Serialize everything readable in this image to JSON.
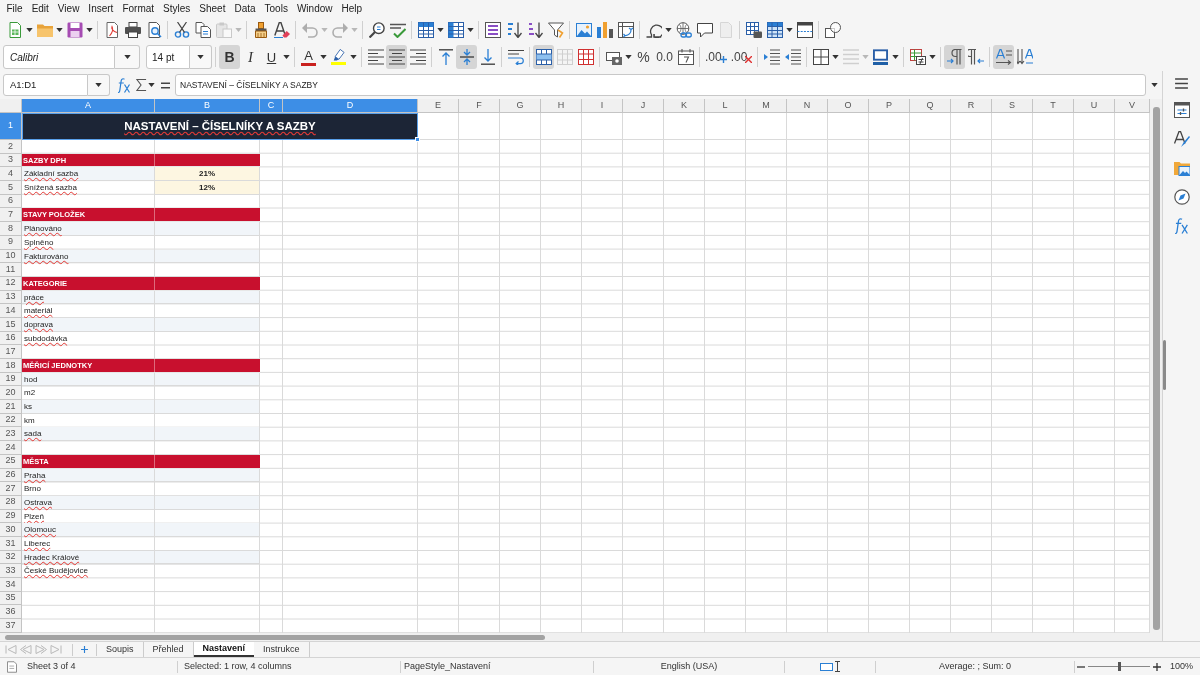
{
  "menu_bar": [
    "File",
    "Edit",
    "View",
    "Insert",
    "Format",
    "Styles",
    "Sheet",
    "Data",
    "Tools",
    "Window",
    "Help"
  ],
  "standard_toolbar": [
    [
      {
        "kind": "new",
        "dropdown": true,
        "disabled": false
      },
      {
        "kind": "open",
        "dropdown": true,
        "disabled": false
      },
      {
        "kind": "save",
        "dropdown": true,
        "disabled": false
      }
    ],
    [
      {
        "kind": "pdf",
        "dropdown": false,
        "disabled": false
      },
      {
        "kind": "print",
        "dropdown": false,
        "disabled": false
      },
      {
        "kind": "preview",
        "dropdown": false,
        "disabled": false
      }
    ],
    [
      {
        "kind": "cut",
        "dropdown": false,
        "disabled": false
      },
      {
        "kind": "copy",
        "dropdown": false,
        "disabled": false
      },
      {
        "kind": "paste",
        "dropdown": true,
        "disabled": true
      }
    ],
    [
      {
        "kind": "clone",
        "dropdown": false,
        "disabled": false
      },
      {
        "kind": "clear",
        "dropdown": false,
        "disabled": false
      }
    ],
    [
      {
        "kind": "undo",
        "dropdown": true,
        "disabled": true
      },
      {
        "kind": "redo",
        "dropdown": true,
        "disabled": true
      }
    ],
    [
      {
        "kind": "find",
        "dropdown": false,
        "disabled": false
      },
      {
        "kind": "spelling",
        "dropdown": false,
        "disabled": false
      }
    ],
    [
      {
        "kind": "row",
        "dropdown": true,
        "disabled": false
      },
      {
        "kind": "column",
        "dropdown": true,
        "disabled": false
      }
    ],
    [
      {
        "kind": "sort",
        "dropdown": false,
        "disabled": false
      },
      {
        "kind": "ascending",
        "dropdown": false,
        "disabled": false
      },
      {
        "kind": "descending",
        "dropdown": false,
        "disabled": false
      },
      {
        "kind": "filter",
        "dropdown": false,
        "disabled": false
      }
    ],
    [
      {
        "kind": "image",
        "dropdown": false,
        "disabled": false
      },
      {
        "kind": "chart",
        "dropdown": false,
        "disabled": false
      },
      {
        "kind": "pivot",
        "dropdown": false,
        "disabled": false
      }
    ],
    [
      {
        "kind": "special",
        "dropdown": true,
        "disabled": false
      },
      {
        "kind": "hyperlink",
        "dropdown": false,
        "disabled": false
      },
      {
        "kind": "comment",
        "dropdown": false,
        "disabled": false
      },
      {
        "kind": "headers",
        "dropdown": false,
        "disabled": true
      }
    ],
    [
      {
        "kind": "printarea",
        "dropdown": false,
        "disabled": false
      },
      {
        "kind": "freeze",
        "dropdown": true,
        "disabled": false
      },
      {
        "kind": "split",
        "dropdown": false,
        "disabled": false
      }
    ],
    [
      {
        "kind": "shapes",
        "dropdown": false,
        "disabled": false
      }
    ]
  ],
  "formatting_toolbar": {
    "font_name": "Calibri",
    "font_size": "14 pt",
    "groups": [
      [
        {
          "kind": "bold",
          "glyph": "B",
          "pressed": true,
          "disabled": false,
          "dropdown": false
        },
        {
          "kind": "italic",
          "glyph": "I",
          "pressed": false,
          "disabled": false,
          "dropdown": false
        },
        {
          "kind": "underline",
          "glyph": "U",
          "pressed": false,
          "disabled": false,
          "dropdown": true
        }
      ],
      [
        {
          "kind": "fontcolor",
          "glyph": "A",
          "color": "#c9211e",
          "pressed": false,
          "disabled": false,
          "dropdown": true
        },
        {
          "kind": "highlight",
          "color": "#ffff00",
          "pressed": false,
          "disabled": false,
          "dropdown": true
        }
      ],
      [
        {
          "kind": "left",
          "pressed": false,
          "disabled": false,
          "dropdown": false
        },
        {
          "kind": "center",
          "pressed": true,
          "disabled": false,
          "dropdown": false
        },
        {
          "kind": "right",
          "pressed": false,
          "disabled": false,
          "dropdown": false
        }
      ],
      [
        {
          "kind": "top",
          "pressed": false,
          "disabled": false,
          "dropdown": false
        },
        {
          "kind": "middle",
          "pressed": true,
          "disabled": false,
          "dropdown": false
        },
        {
          "kind": "bottom",
          "pressed": false,
          "disabled": false,
          "dropdown": false
        }
      ],
      [
        {
          "kind": "wrap",
          "pressed": false,
          "disabled": false,
          "dropdown": false
        }
      ],
      [
        {
          "kind": "mergecenter",
          "pressed": true,
          "disabled": false,
          "dropdown": false
        },
        {
          "kind": "merge",
          "pressed": false,
          "disabled": true,
          "dropdown": false
        },
        {
          "kind": "unmerge",
          "pressed": false,
          "disabled": false,
          "dropdown": false
        }
      ],
      [
        {
          "kind": "currency",
          "pressed": false,
          "disabled": false,
          "dropdown": true
        },
        {
          "kind": "percent",
          "glyph": "%",
          "pressed": false,
          "disabled": false,
          "dropdown": false
        },
        {
          "kind": "number",
          "glyph": "0.0",
          "pressed": false,
          "disabled": false,
          "dropdown": false
        },
        {
          "kind": "date",
          "pressed": false,
          "disabled": false,
          "dropdown": false
        }
      ],
      [
        {
          "kind": "adddecimal",
          "glyph": ".00",
          "pressed": false,
          "disabled": false,
          "dropdown": false
        },
        {
          "kind": "deldecimal",
          "glyph": ".00",
          "pressed": false,
          "disabled": false,
          "dropdown": false
        }
      ],
      [
        {
          "kind": "indent",
          "pressed": false,
          "disabled": false,
          "dropdown": false
        },
        {
          "kind": "outdent",
          "pressed": false,
          "disabled": false,
          "dropdown": false
        }
      ],
      [
        {
          "kind": "borders",
          "pressed": false,
          "disabled": false,
          "dropdown": true
        },
        {
          "kind": "borderstyle",
          "pressed": false,
          "disabled": true,
          "dropdown": true
        },
        {
          "kind": "bordercolor",
          "color": "#1f5fa6",
          "pressed": false,
          "disabled": false,
          "dropdown": true
        }
      ],
      [
        {
          "kind": "conditional",
          "pressed": false,
          "disabled": false,
          "dropdown": true
        }
      ],
      [
        {
          "kind": "ltr",
          "pressed": true,
          "disabled": false,
          "dropdown": false
        },
        {
          "kind": "rtl",
          "pressed": false,
          "disabled": false,
          "dropdown": false
        }
      ],
      [
        {
          "kind": "horizontal",
          "pressed": true,
          "disabled": false,
          "dropdown": false
        },
        {
          "kind": "vertical",
          "pressed": false,
          "disabled": false,
          "dropdown": false
        }
      ]
    ]
  },
  "formula_bar": {
    "name_box": "A1:D1",
    "formula": "NASTAVENÍ – ČÍSELNÍKY A SAZBY"
  },
  "sheet": {
    "columns": [
      {
        "label": "A",
        "selected": true
      },
      {
        "label": "B",
        "selected": true
      },
      {
        "label": "C",
        "selected": true
      },
      {
        "label": "D",
        "selected": true
      },
      {
        "label": "E",
        "selected": false
      },
      {
        "label": "F",
        "selected": false
      },
      {
        "label": "G",
        "selected": false
      },
      {
        "label": "H",
        "selected": false
      },
      {
        "label": "I",
        "selected": false
      },
      {
        "label": "J",
        "selected": false
      },
      {
        "label": "K",
        "selected": false
      },
      {
        "label": "L",
        "selected": false
      },
      {
        "label": "M",
        "selected": false
      },
      {
        "label": "N",
        "selected": false
      },
      {
        "label": "O",
        "selected": false
      },
      {
        "label": "P",
        "selected": false
      },
      {
        "label": "Q",
        "selected": false
      },
      {
        "label": "R",
        "selected": false
      },
      {
        "label": "S",
        "selected": false
      },
      {
        "label": "T",
        "selected": false
      },
      {
        "label": "U",
        "selected": false
      },
      {
        "label": "V",
        "selected": false
      }
    ],
    "rows": [
      {
        "label": "1",
        "selected": true,
        "kind": "title",
        "title": "NASTAVENÍ – ČÍSELNÍKY A SAZBY",
        "misspelled": true
      },
      {
        "label": "2",
        "selected": false,
        "kind": "empty"
      },
      {
        "label": "3",
        "selected": false,
        "kind": "section",
        "text": "SAZBY DPH",
        "misspelled": false
      },
      {
        "label": "4",
        "selected": false,
        "kind": "rate",
        "text": "Základní sazba",
        "misspelled": true,
        "value": "21%"
      },
      {
        "label": "5",
        "selected": false,
        "kind": "rate",
        "text": "Snížená sazba",
        "misspelled": true,
        "value": "12%"
      },
      {
        "label": "6",
        "selected": false,
        "kind": "empty"
      },
      {
        "label": "7",
        "selected": false,
        "kind": "section",
        "text": "STAVY POLOŽEK",
        "misspelled": false
      },
      {
        "label": "8",
        "selected": false,
        "kind": "item",
        "text": "Plánováno",
        "misspelled": true
      },
      {
        "label": "9",
        "selected": false,
        "kind": "item",
        "text": "Splněno",
        "misspelled": true
      },
      {
        "label": "10",
        "selected": false,
        "kind": "item",
        "text": "Fakturováno",
        "misspelled": true
      },
      {
        "label": "11",
        "selected": false,
        "kind": "empty"
      },
      {
        "label": "12",
        "selected": false,
        "kind": "section",
        "text": "KATEGORIE",
        "misspelled": false
      },
      {
        "label": "13",
        "selected": false,
        "kind": "item",
        "text": "práce",
        "misspelled": true
      },
      {
        "label": "14",
        "selected": false,
        "kind": "item",
        "text": "materiál",
        "misspelled": true
      },
      {
        "label": "15",
        "selected": false,
        "kind": "item",
        "text": "doprava",
        "misspelled": true
      },
      {
        "label": "16",
        "selected": false,
        "kind": "item",
        "text": "subdodávka",
        "misspelled": true
      },
      {
        "label": "17",
        "selected": false,
        "kind": "empty"
      },
      {
        "label": "18",
        "selected": false,
        "kind": "section",
        "text": "MĚŘICÍ JEDNOTKY",
        "misspelled": false
      },
      {
        "label": "19",
        "selected": false,
        "kind": "item",
        "text": "hod",
        "misspelled": false
      },
      {
        "label": "20",
        "selected": false,
        "kind": "item",
        "text": "m2",
        "misspelled": false
      },
      {
        "label": "21",
        "selected": false,
        "kind": "item",
        "text": "ks",
        "misspelled": false
      },
      {
        "label": "22",
        "selected": false,
        "kind": "item",
        "text": "km",
        "misspelled": false
      },
      {
        "label": "23",
        "selected": false,
        "kind": "item",
        "text": "sada",
        "misspelled": true
      },
      {
        "label": "24",
        "selected": false,
        "kind": "empty"
      },
      {
        "label": "25",
        "selected": false,
        "kind": "section",
        "text": "MĚSTA",
        "misspelled": false
      },
      {
        "label": "26",
        "selected": false,
        "kind": "item",
        "text": "Praha",
        "misspelled": true
      },
      {
        "label": "27",
        "selected": false,
        "kind": "item",
        "text": "Brno",
        "misspelled": false
      },
      {
        "label": "28",
        "selected": false,
        "kind": "item",
        "text": "Ostrava",
        "misspelled": true
      },
      {
        "label": "29",
        "selected": false,
        "kind": "item",
        "text": "Plzeň",
        "misspelled": true
      },
      {
        "label": "30",
        "selected": false,
        "kind": "item",
        "text": "Olomouc",
        "misspelled": true
      },
      {
        "label": "31",
        "selected": false,
        "kind": "item",
        "text": "Liberec",
        "misspelled": true
      },
      {
        "label": "32",
        "selected": false,
        "kind": "item",
        "text": "Hradec Králové",
        "misspelled": true
      },
      {
        "label": "33",
        "selected": false,
        "kind": "item",
        "text": "České Budějovice",
        "misspelled": true
      },
      {
        "label": "34",
        "selected": false,
        "kind": "empty"
      },
      {
        "label": "35",
        "selected": false,
        "kind": "empty"
      },
      {
        "label": "36",
        "selected": false,
        "kind": "empty"
      },
      {
        "label": "37",
        "selected": false,
        "kind": "empty"
      }
    ]
  },
  "sheet_tabs": [
    {
      "label": "Soupis",
      "selected": false
    },
    {
      "label": "Přehled",
      "selected": false
    },
    {
      "label": "Nastavení",
      "selected": true
    },
    {
      "label": "Instrukce",
      "selected": false
    }
  ],
  "status_bar": {
    "sheet": "Sheet 3 of 4",
    "selection": "Selected: 1 row, 4 columns",
    "page_style": "PageStyle_Nastavení",
    "language": "English (USA)",
    "summary": "Average: ; Sum: 0",
    "zoom": {
      "level": 0.5,
      "label": "100%"
    }
  }
}
